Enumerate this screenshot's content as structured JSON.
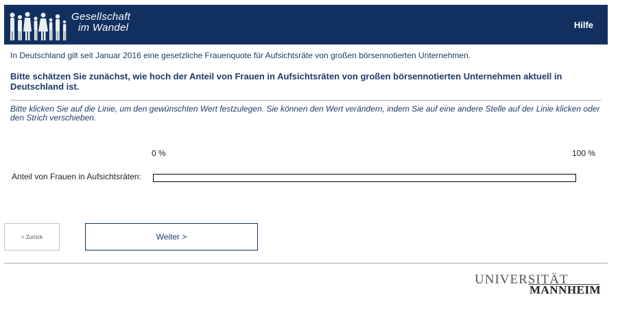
{
  "header": {
    "logo_line1": "Gesellschaft",
    "logo_line2": "im Wandel",
    "help_label": "Hilfe"
  },
  "intro_text": "In Deutschland gilt seit Januar 2016 eine gesetzliche Frauenquote für Aufsichtsräte von großen börsennotierten Unternehmen.",
  "question_text": "Bitte schätzen Sie zunächst, wie hoch der Anteil von Frauen in Aufsichtsräten von großen börsennotierten Unternehmen aktuell in Deutschland ist.",
  "instruction_text": "Bitte klicken Sie auf die Linie, um den gewünschten Wert festzulegen. Sie können den Wert verändern, indem Sie auf eine andere Stelle auf der Linie klicken oder den Strich verschieben.",
  "slider": {
    "min_label": "0 %",
    "max_label": "100 %",
    "label": "Anteil von Frauen in Aufsichtsräten:",
    "value": null
  },
  "navigation": {
    "back_label": "< Zurück",
    "next_label": "Weiter >"
  },
  "footer": {
    "logo_top": "UNIVERSITÄT",
    "logo_bottom": "MANNHEIM"
  },
  "colors": {
    "header_bg": "#12305f",
    "text_blue": "#1e3a66"
  }
}
